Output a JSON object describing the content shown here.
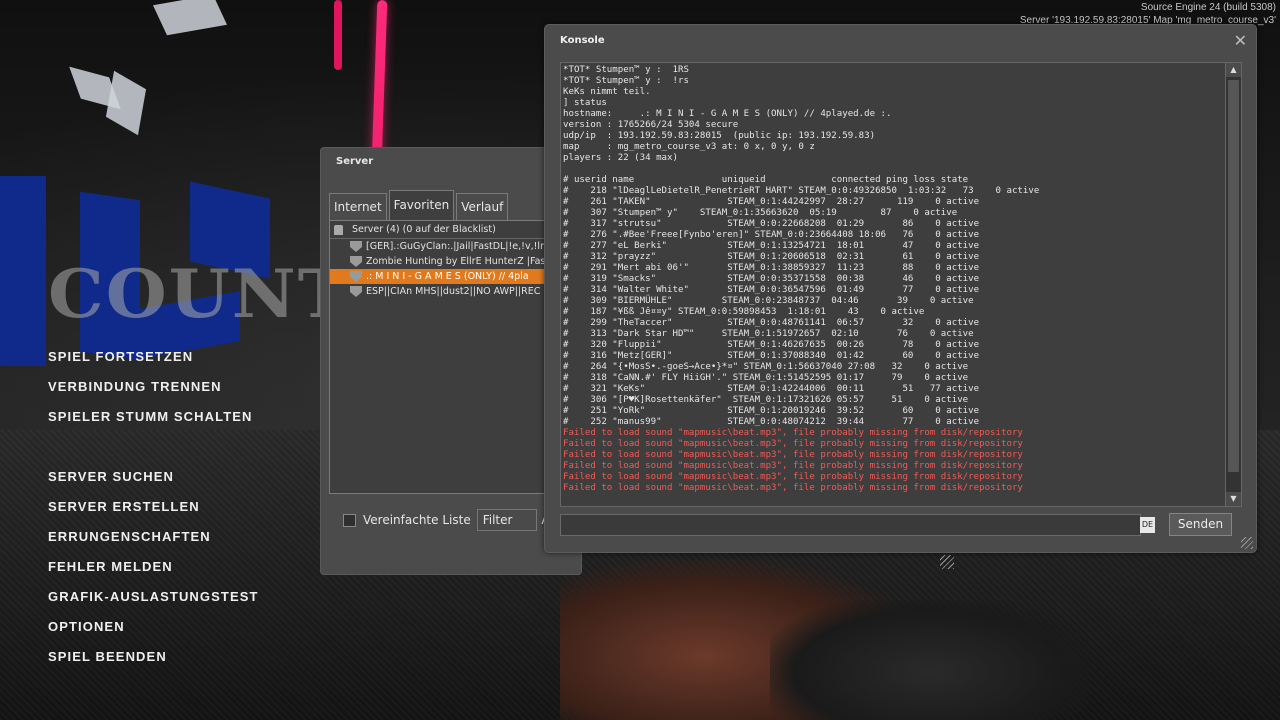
{
  "engine_info": {
    "line1": "Source Engine 24 (build 5308)",
    "line2": "Server '193.192.59.83:28015' Map 'mg_metro_course_v3'"
  },
  "logo": {
    "text": "COUNTER-STRIKE"
  },
  "main_menu": {
    "group1": [
      "SPIEL FORTSETZEN",
      "VERBINDUNG TRENNEN",
      "SPIELER STUMM SCHALTEN"
    ],
    "group2": [
      "SERVER SUCHEN",
      "SERVER ERSTELLEN",
      "ERRUNGENSCHAFTEN",
      "FEHLER MELDEN",
      "GRAFIK-AUSLASTUNGSTEST",
      "OPTIONEN",
      "SPIEL BEENDEN"
    ]
  },
  "server_window": {
    "title": "Server",
    "tabs": [
      "Internet",
      "Favoriten",
      "Verlauf"
    ],
    "active_tab": "Favoriten",
    "list_header": "Server (4) (0 auf der Blacklist)",
    "servers": [
      "[GER].:GuGyClan:.|Jail|FastDL|!e,!v,!lr|",
      "Zombie Hunting by EllrE HunterZ |FastD",
      ".: M I N I - G A M E S (ONLY) // 4pla",
      "ESP||CIAn MHS||dust2||NO AWP||REC"
    ],
    "selected_index": 2,
    "simple_list_label": "Vereinfachte Liste",
    "filter_label": "Filter",
    "extra_label": "Ak"
  },
  "console": {
    "title": "Konsole",
    "lines": [
      "*TOT* Stumpen™ y :  1RS",
      "*TOT* Stumpen™ y :  !rs",
      "KeKs nimmt teil.",
      "] status",
      "hostname:     .: M I N I - G A M E S (ONLY) // 4played.de :.",
      "version : 1765266/24 5304 secure",
      "udp/ip  : 193.192.59.83:28015  (public ip: 193.192.59.83)",
      "map     : mg_metro_course_v3 at: 0 x, 0 y, 0 z",
      "players : 22 (34 max)",
      "",
      "# userid name                uniqueid            connected ping loss state",
      "#    218 \"lDeaglLeDietelR_PenetrieRT HART\" STEAM_0:0:49326850  1:03:32   73    0 active",
      "#    261 \"TAKEN\"              STEAM_0:1:44242997  28:27      119    0 active",
      "#    307 \"Stumpen™ y\"    STEAM_0:1:35663620  05:19        87    0 active",
      "#    317 \"strutsu\"            STEAM_0:0:22668208  01:29       86    0 active",
      "#    276 \".#Bee'Freee[Fynbo'eren]\" STEAM_0:0:23664408 18:06   76    0 active",
      "#    277 \"eL Berki\"           STEAM_0:1:13254721  18:01       47    0 active",
      "#    312 \"prayzz\"             STEAM_0:1:20606518  02:31       61    0 active",
      "#    291 \"Mert abi 06'\"       STEAM_0:1:38859327  11:23       88    0 active",
      "#    319 \"Smacks\"             STEAM_0:0:35371558  00:38       46    0 active",
      "#    314 \"Walter White\"       STEAM_0:0:36547596  01:49       77    0 active",
      "#    309 \"BIERMÜHLE\"         STEAM_0:0:23848737  04:46       39    0 active",
      "#    187 \"¥ßß Jê¤¤y\" STEAM_0:0:59898453  1:18:01    43    0 active",
      "#    299 \"TheTaccer\"          STEAM_0:0:48761141  06:57       32    0 active",
      "#    313 \"Dark Star HD™\"     STEAM_0:1:51972657  02:10       76    0 active",
      "#    320 \"Fluppii\"            STEAM_0:1:46267635  00:26       78    0 active",
      "#    316 \"Metz[GER]\"          STEAM_0:1:37088340  01:42       60    0 active",
      "#    264 \"{•MosS•.-goeS→Ace•}*¤\" STEAM_0:1:56637040 27:08   32    0 active",
      "#    318 \"CaNN.#' FLY HiiGH'.\" STEAM_0:1:51452595 01:17     79    0 active",
      "#    321 \"KeKs\"               STEAM_0:1:42244006  00:11       51   77 active",
      "#    306 \"[P♥K]Rosettenkäfer\"  STEAM_0:1:17321626 05:57     51    0 active",
      "#    251 \"YoRk\"               STEAM_0:1:20019246  39:52       60    0 active",
      "#    252 \"manus99\"            STEAM_0:0:48074212  39:44       77    0 active"
    ],
    "errors": [
      "Failed to load sound \"mapmusic\\beat.mp3\", file probably missing from disk/repository",
      "Failed to load sound \"mapmusic\\beat.mp3\", file probably missing from disk/repository",
      "Failed to load sound \"mapmusic\\beat.mp3\", file probably missing from disk/repository",
      "Failed to load sound \"mapmusic\\beat.mp3\", file probably missing from disk/repository",
      "Failed to load sound \"mapmusic\\beat.mp3\", file probably missing from disk/repository",
      "Failed to load sound \"mapmusic\\beat.mp3\", file probably missing from disk/repository"
    ],
    "input_value": "",
    "lang_indicator": "DE",
    "send_label": "Senden",
    "close_symbol": "✕",
    "error_color": "#f25a55"
  }
}
